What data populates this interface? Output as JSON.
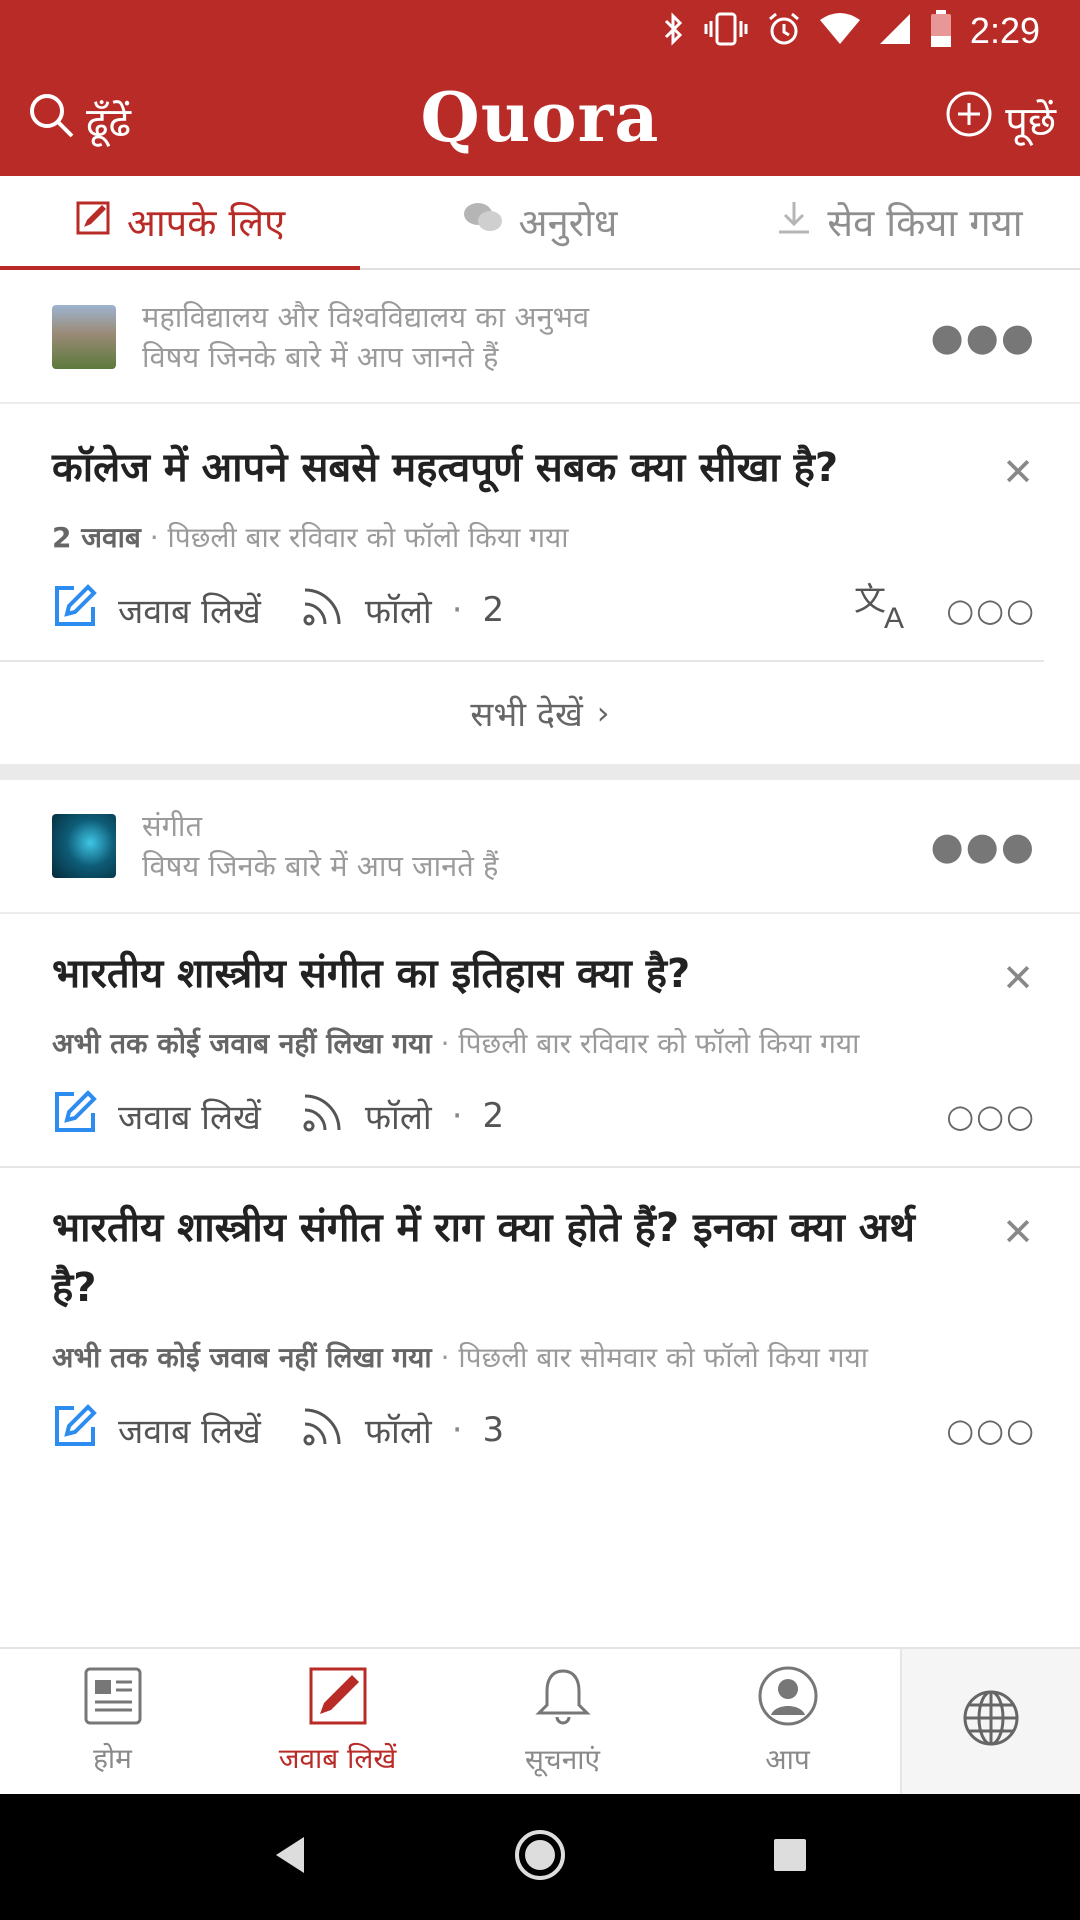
{
  "status_bar": {
    "time": "2:29"
  },
  "app_bar": {
    "search_label": "ढूँढें",
    "logo": "Quora",
    "ask_label": "पूछें"
  },
  "tabs": [
    {
      "label": "आपके लिए"
    },
    {
      "label": "अनुरोध"
    },
    {
      "label": "सेव किया गया"
    }
  ],
  "sections": [
    {
      "topic": {
        "title": "महाविद्यालय और विश्वविद्यालय का अनुभव",
        "subtitle": "विषय जिनके बारे में आप जानते हैं"
      },
      "questions": [
        {
          "title": "कॉलेज में आपने सबसे महत्वपूर्ण सबक क्या सीखा है?",
          "answers": "2 जवाब",
          "followed": "पिछली बार रविवार को फॉलो किया गया",
          "write_label": "जवाब लिखें",
          "follow_label": "फॉलो",
          "follow_count": "2"
        }
      ],
      "see_all": "सभी देखें"
    },
    {
      "topic": {
        "title": "संगीत",
        "subtitle": "विषय जिनके बारे में आप जानते हैं"
      },
      "questions": [
        {
          "title": "भारतीय शास्त्रीय संगीत का इतिहास क्या है?",
          "answers": "अभी तक कोई जवाब नहीं लिखा गया",
          "followed": "पिछली बार रविवार को फॉलो किया गया",
          "write_label": "जवाब लिखें",
          "follow_label": "फॉलो",
          "follow_count": "2"
        },
        {
          "title": "भारतीय शास्त्रीय संगीत में राग क्या होते हैं? इनका क्या अर्थ है?",
          "answers": "अभी तक कोई जवाब नहीं लिखा गया",
          "followed": "पिछली बार सोमवार को फॉलो किया गया",
          "write_label": "जवाब लिखें",
          "follow_label": "फॉलो",
          "follow_count": "3"
        }
      ]
    }
  ],
  "bottom_nav": [
    {
      "label": "होम"
    },
    {
      "label": "जवाब लिखें"
    },
    {
      "label": "सूचनाएं"
    },
    {
      "label": "आप"
    }
  ],
  "colors": {
    "brand": "#b92b27",
    "accent_blue": "#2d8cf0"
  }
}
